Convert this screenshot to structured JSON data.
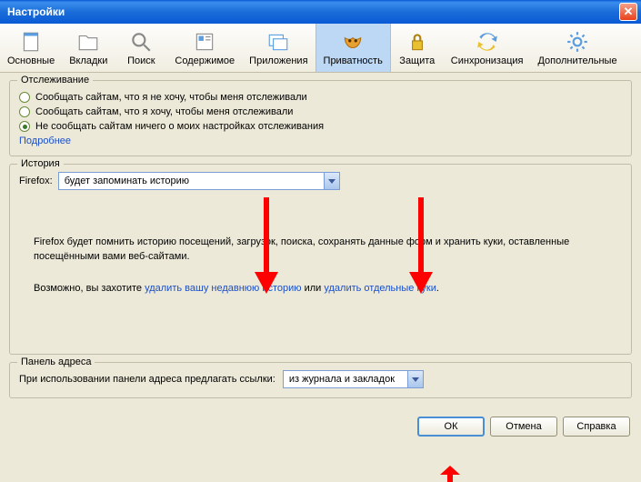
{
  "window": {
    "title": "Настройки"
  },
  "toolbar": {
    "items": [
      {
        "label": "Основные"
      },
      {
        "label": "Вкладки"
      },
      {
        "label": "Поиск"
      },
      {
        "label": "Содержимое"
      },
      {
        "label": "Приложения"
      },
      {
        "label": "Приватность"
      },
      {
        "label": "Защита"
      },
      {
        "label": "Синхронизация"
      },
      {
        "label": "Дополнительные"
      }
    ]
  },
  "tracking": {
    "legend": "Отслеживание",
    "opt1": "Сообщать сайтам, что я не хочу, чтобы меня отслеживали",
    "opt2": "Сообщать сайтам, что я хочу, чтобы меня отслеживали",
    "opt3": "Не сообщать сайтам ничего о моих настройках отслеживания",
    "more": "Подробнее"
  },
  "history": {
    "legend": "История",
    "prefix": "Firefox:",
    "combo": "будет запоминать историю",
    "desc": "Firefox будет помнить историю посещений, загрузок, поиска, сохранять данные форм и хранить куки, оставленные посещёнными вами веб-сайтами.",
    "maybe_prefix": "Возможно, вы захотите ",
    "link1": "удалить вашу недавнюю историю",
    "or": " или ",
    "link2": "удалить отдельные куки",
    "suffix": "."
  },
  "addressbar": {
    "legend": "Панель адреса",
    "label": "При использовании панели адреса предлагать ссылки:",
    "combo": "из журнала и закладок"
  },
  "buttons": {
    "ok": "ОК",
    "cancel": "Отмена",
    "help": "Справка"
  }
}
